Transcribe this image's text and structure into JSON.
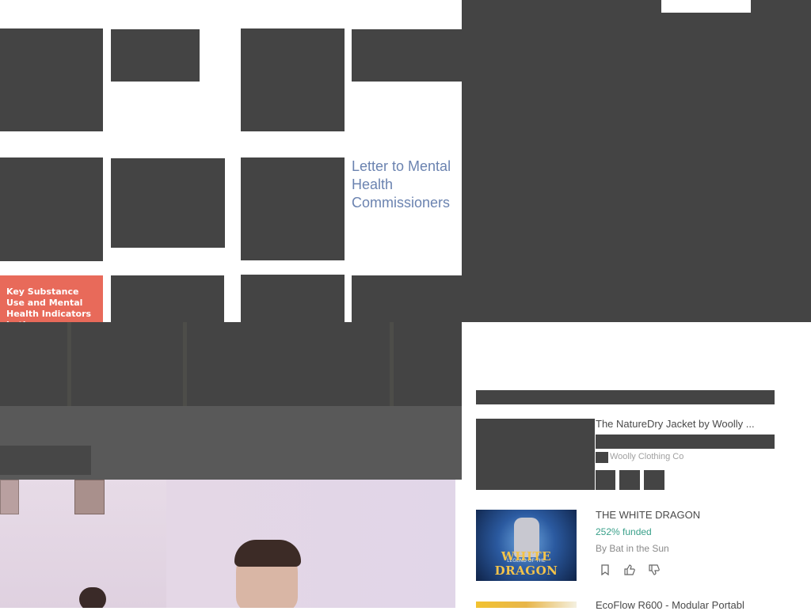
{
  "left_grid": {
    "featured_title": "Letter to Mental Health Commissioners",
    "report_thumb_text": "Key Substance Use and Mental Health Indicators in the"
  },
  "projects": {
    "items": [
      {
        "title": "The NatureDry Jacket by Woolly ...",
        "by": "Woolly Clothing Co"
      },
      {
        "title": "THE WHITE DRAGON",
        "funded": "252% funded",
        "by": "By Bat in the Sun",
        "thumb_subtitle": "LEGEND OF THE",
        "thumb_logo": "WHITE DRAGON"
      },
      {
        "title": "EcoFlow R600 - Modular Portabl"
      }
    ]
  },
  "icons": {
    "bookmark": "bookmark-icon",
    "thumbs_up": "thumbs-up-icon",
    "thumbs_down": "thumbs-down-icon"
  },
  "colors": {
    "placeholder": "#444444",
    "link": "#6b83b0",
    "funded": "#3aa08a",
    "report_thumb": "#e86a5a"
  }
}
